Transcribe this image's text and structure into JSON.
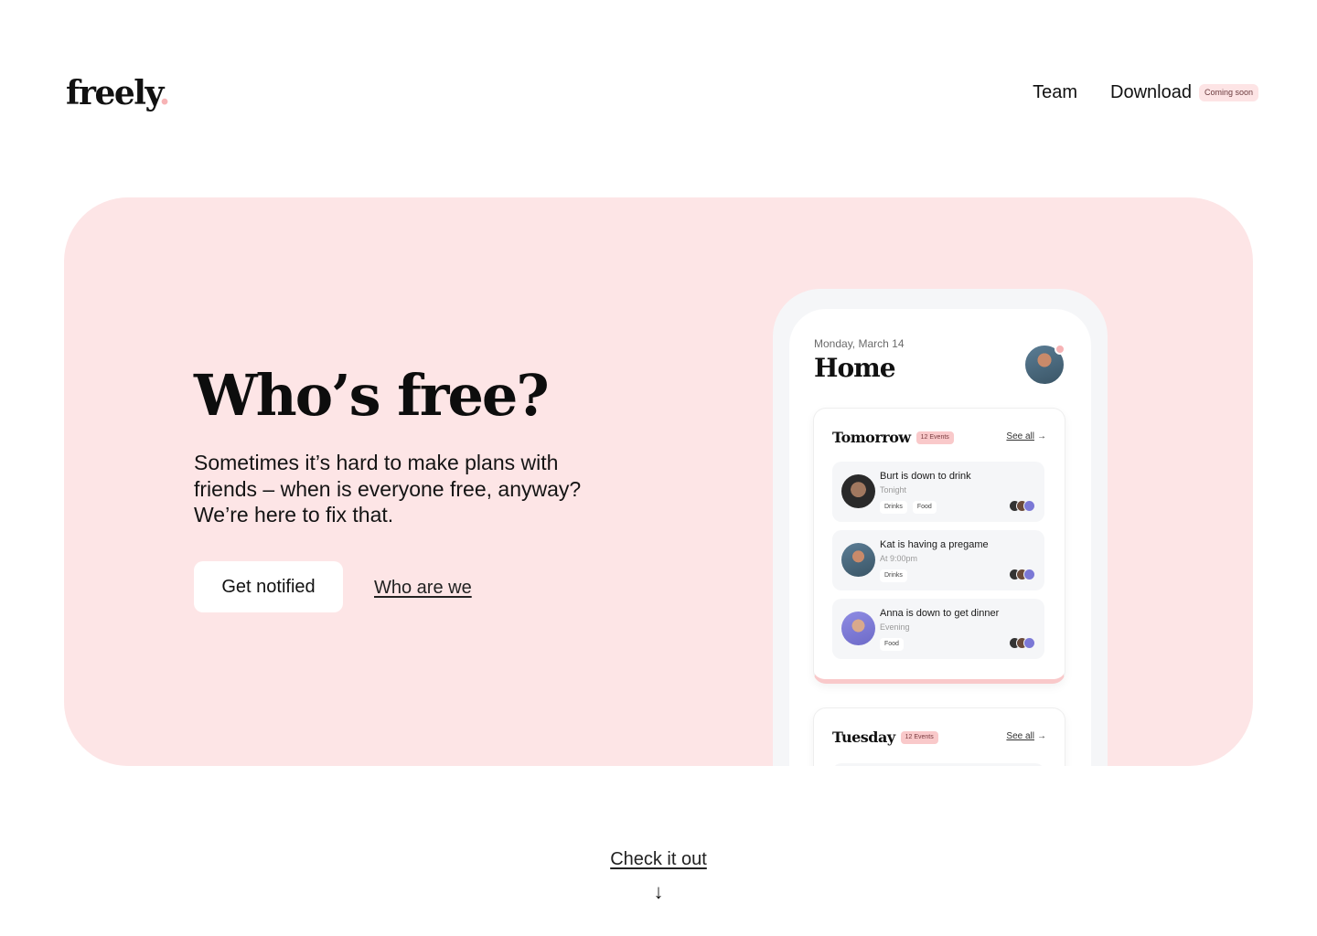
{
  "header": {
    "logo_text": "freely",
    "logo_dot": ".",
    "nav": {
      "team_label": "Team",
      "download_label": "Download",
      "download_badge": "Coming soon"
    }
  },
  "hero": {
    "headline": "Who’s free?",
    "subtext": "Sometimes it’s hard to make plans with friends – when is everyone free, anyway? We’re here to fix that.",
    "primary_button": "Get notified",
    "secondary_link": "Who are we"
  },
  "phone": {
    "date": "Monday, March 14",
    "title": "Home",
    "sections": [
      {
        "title": "Tomorrow",
        "badge": "12 Events",
        "see_all": "See all",
        "events": [
          {
            "title": "Burt is down to drink",
            "time": "Tonight",
            "tags": [
              "Drinks",
              "Food"
            ]
          },
          {
            "title": "Kat is having a pregame",
            "time": "At 9:00pm",
            "tags": [
              "Drinks"
            ]
          },
          {
            "title": "Anna is down to get dinner",
            "time": "Evening",
            "tags": [
              "Food"
            ]
          }
        ]
      },
      {
        "title": "Tuesday",
        "badge": "12 Events",
        "see_all": "See all"
      }
    ],
    "arrow_glyph": "→"
  },
  "footer": {
    "cta_link": "Check it out",
    "down_arrow": "↓"
  },
  "colors": {
    "hero_bg": "#fde5e6",
    "accent_pink": "#f7b3b5",
    "badge_pink": "#f9c9ca",
    "card_bg": "#f5f6f8"
  }
}
